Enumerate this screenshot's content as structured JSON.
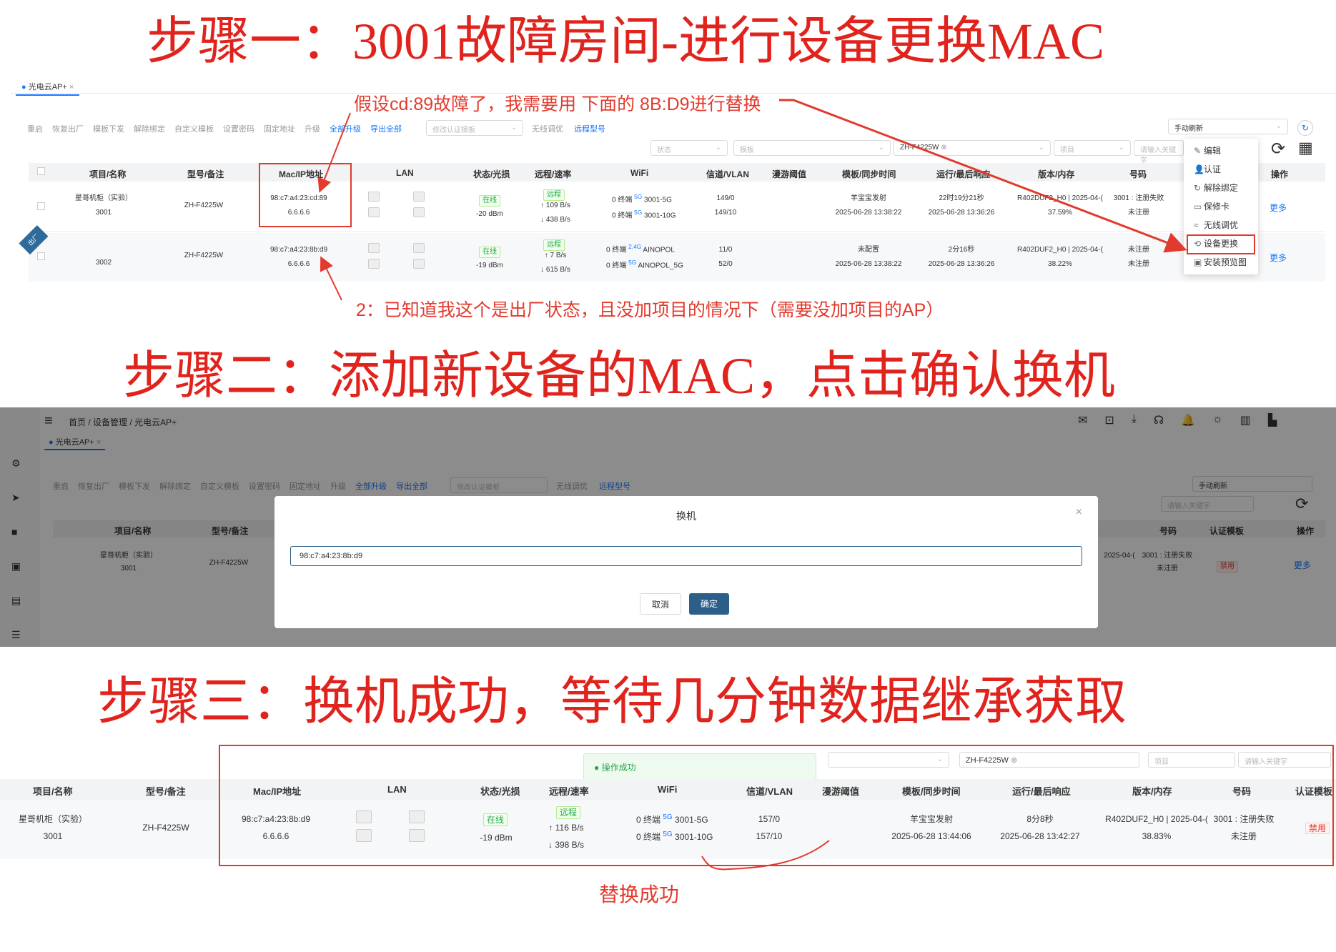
{
  "steps": {
    "step1": "步骤一：3001故障房间-进行设备更换MAC",
    "step2": "步骤二：添加新设备的MAC，点击确认换机",
    "step3": "步骤三：换机成功，等待几分钟数据继承获取"
  },
  "annotations": {
    "assume": "假设cd:89故障了，我需要用 下面的 8B:D9进行替换",
    "note2": "2：已知道我这个是出厂状态，且没加项目的情况下（需要没加项目的AP）",
    "success": "替换成功"
  },
  "tab": {
    "label": "光电云AP+",
    "close": "×"
  },
  "toolbar": {
    "items": [
      "重启",
      "恢复出厂",
      "模板下发",
      "解除绑定",
      "自定义模板",
      "设置密码",
      "固定地址",
      "升级"
    ],
    "blue_items": [
      "全部升级",
      "导出全部"
    ],
    "select_placeholder": "修改认证模板",
    "items2": [
      "无线调优"
    ],
    "remote_model": "远程型号",
    "refresh_select": "手动刷新"
  },
  "filters": {
    "status": "状态",
    "template": "模板",
    "model": "ZH-F4225W",
    "project": "项目",
    "keyword": "请输入关键字"
  },
  "columns": [
    "项目/名称",
    "型号/备注",
    "Mac/IP地址",
    "LAN",
    "状态/光损",
    "远程/速率",
    "WiFi",
    "信道/VLAN",
    "漫游阈值",
    "模板/同步时间",
    "运行/最后响应",
    "版本/内存",
    "号码",
    "操作"
  ],
  "rows1": [
    {
      "name": "星哥机柜（实验）",
      "room": "3001",
      "model": "ZH-F4225W",
      "mac": "98:c7:a4:23:cd:89",
      "ip": "6.6.6.6",
      "status": "在线",
      "signal": "-20 dBm",
      "remote": "远程",
      "up": "↑ 109 B/s",
      "down": "↓ 438 B/s",
      "wifi1_count": "0 终端",
      "wifi1_band": "5G",
      "wifi1_ssid": "3001-5G",
      "wifi2_count": "0 终端",
      "wifi2_band": "5G",
      "wifi2_ssid": "3001-10G",
      "channel": "149/0",
      "vlan": "149/10",
      "template": "羊宝宝发射",
      "sync": "2025-06-28 13:38:22",
      "uptime": "22时19分21秒",
      "last": "2025-06-28 13:36:26",
      "version": "R402DUF2_H0 | 2025-04-(",
      "memory": "37.59%",
      "number1": "3001 : 注册失败",
      "number2": "未注册",
      "more": "更多"
    },
    {
      "name": "",
      "room": "3002",
      "model": "ZH-F4225W",
      "mac": "98:c7:a4:23:8b:d9",
      "ip": "6.6.6.6",
      "status": "在线",
      "signal": "-19 dBm",
      "remote": "远程",
      "up": "↑ 7 B/s",
      "down": "↓ 615 B/s",
      "wifi1_count": "0 终端",
      "wifi1_band": "2.4G",
      "wifi1_ssid": "AINOPOL",
      "wifi2_count": "0 终端",
      "wifi2_band": "5G",
      "wifi2_ssid": "AINOPOL_5G",
      "channel": "11/0",
      "vlan": "52/0",
      "template": "未配置",
      "sync": "2025-06-28 13:38:22",
      "uptime": "2分16秒",
      "last": "2025-06-28 13:36:26",
      "version": "R402DUF2_H0 | 2025-04-(",
      "memory": "38.22%",
      "number1": "未注册",
      "number2": "未注册",
      "more": "更多",
      "ribbon": "出厂"
    }
  ],
  "menu": [
    "编辑",
    "认证",
    "解除绑定",
    "保修卡",
    "无线调优",
    "设备更换",
    "安装预览图"
  ],
  "step2ui": {
    "breadcrumb": [
      "首页",
      "设备管理",
      "光电云AP+"
    ],
    "auth_template": "认证模板",
    "dialog_title": "换机",
    "dialog_close": "×",
    "mac_input": "98:c7:a4:23:8b:d9",
    "cancel": "取消",
    "confirm": "确定",
    "row": {
      "name": "星哥机柜（实验）",
      "room": "3001",
      "model": "ZH-F4225W",
      "version": "2025-04-(",
      "number1": "3001 : 注册失败",
      "number2": "未注册",
      "auth": "禁用",
      "more": "更多"
    }
  },
  "step3ui": {
    "toast": "操作成功",
    "columns": [
      "项目/名称",
      "型号/备注",
      "Mac/IP地址",
      "LAN",
      "状态/光损",
      "远程/速率",
      "WiFi",
      "信道/VLAN",
      "漫游阈值",
      "模板/同步时间",
      "运行/最后响应",
      "版本/内存",
      "号码",
      "认证模板"
    ],
    "row": {
      "name": "星哥机柜（实验）",
      "room": "3001",
      "model": "ZH-F4225W",
      "mac": "98:c7:a4:23:8b:d9",
      "ip": "6.6.6.6",
      "status": "在线",
      "signal": "-19 dBm",
      "remote": "远程",
      "up": "↑ 116 B/s",
      "down": "↓ 398 B/s",
      "wifi1_count": "0 终端",
      "wifi1_band": "5G",
      "wifi1_ssid": "3001-5G",
      "wifi2_count": "0 终端",
      "wifi2_band": "5G",
      "wifi2_ssid": "3001-10G",
      "channel": "157/0",
      "vlan": "157/10",
      "template": "羊宝宝发射",
      "sync": "2025-06-28 13:44:06",
      "uptime": "8分8秒",
      "last": "2025-06-28 13:42:27",
      "version": "R402DUF2_H0 | 2025-04-(",
      "memory": "38.83%",
      "number1": "3001 : 注册失败",
      "number2": "未注册",
      "auth": "禁用"
    }
  },
  "colors": {
    "annotation_red": "#e23a2e",
    "brand_blue": "#1677ff",
    "success_green": "#27a745",
    "confirm_btn": "#2b5f8a"
  }
}
